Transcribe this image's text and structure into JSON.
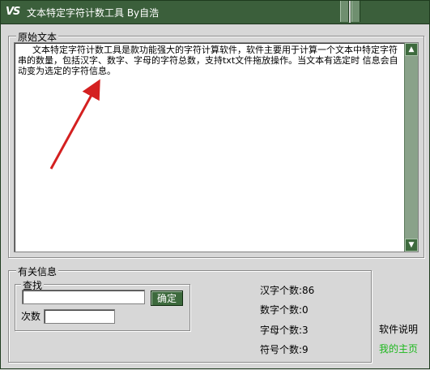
{
  "window": {
    "logo": "VS",
    "title": "文本特定字符计数工具 By自浩"
  },
  "original": {
    "label": "原始文本",
    "text": "文本特定字符计数工具是款功能强大的字符计算软件，软件主要用于计算一个文本中特定字符串的数量，包括汉字、数字、字母的字符总数，支持txt文件拖放操作。当文本有选定时 信息会自动变为选定的字符信息。",
    "scroll_up": "▲",
    "scroll_down": "▼"
  },
  "info": {
    "label": "有关信息",
    "search_label": "查找",
    "count_label": "次数",
    "search_value": "",
    "count_value": "",
    "ok_label": "确定"
  },
  "stats": {
    "hanzi": "汉字个数:86",
    "digits": "数字个数:0",
    "letters": "字母个数:3",
    "symbols": "符号个数:9"
  },
  "links": {
    "help": "软件说明",
    "home": "我的主页"
  },
  "colors": {
    "titlebar": "#3b5f3b",
    "button": "#3d6a3d",
    "link": "#1db81d",
    "arrow": "#d42020"
  }
}
